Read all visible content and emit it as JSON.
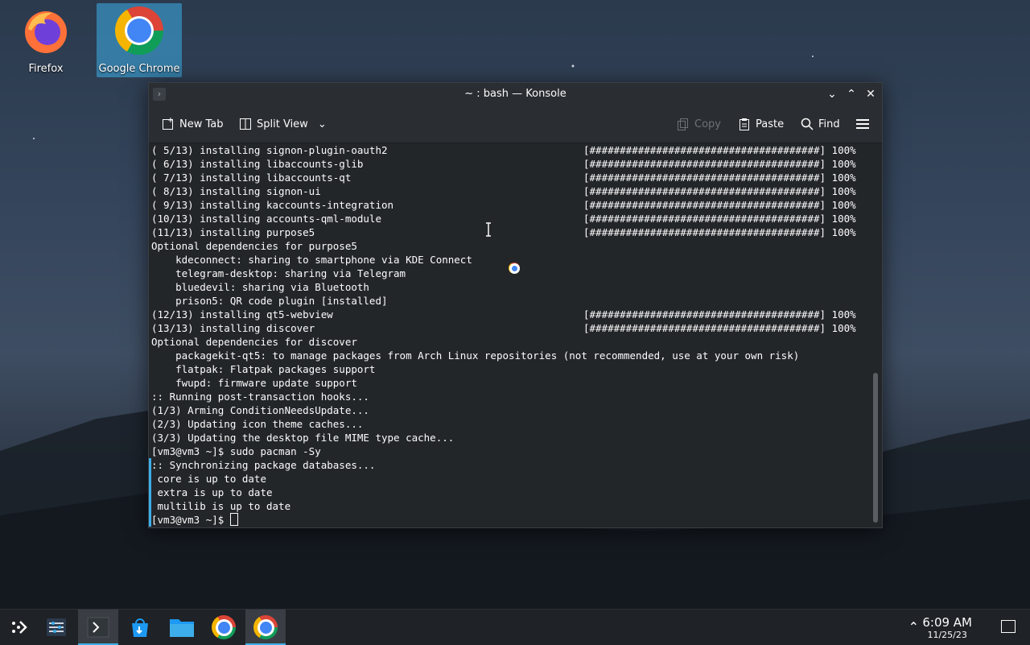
{
  "desktop": {
    "icons": [
      {
        "label": "Firefox"
      },
      {
        "label": "Google Chrome"
      }
    ]
  },
  "window": {
    "title": "~ : bash — Konsole",
    "toolbar": {
      "new_tab": "New Tab",
      "split_view": "Split View",
      "copy": "Copy",
      "paste": "Paste",
      "find": "Find"
    }
  },
  "terminal": {
    "lines": [
      {
        "text": "( 5/13) installing signon-plugin-oauth2",
        "progress": "[######################################] 100%"
      },
      {
        "text": "( 6/13) installing libaccounts-glib",
        "progress": "[######################################] 100%"
      },
      {
        "text": "( 7/13) installing libaccounts-qt",
        "progress": "[######################################] 100%"
      },
      {
        "text": "( 8/13) installing signon-ui",
        "progress": "[######################################] 100%"
      },
      {
        "text": "( 9/13) installing kaccounts-integration",
        "progress": "[######################################] 100%"
      },
      {
        "text": "(10/13) installing accounts-qml-module",
        "progress": "[######################################] 100%"
      },
      {
        "text": "(11/13) installing purpose5",
        "progress": "[######################################] 100%"
      },
      {
        "text": "Optional dependencies for purpose5",
        "progress": ""
      },
      {
        "text": "    kdeconnect: sharing to smartphone via KDE Connect",
        "progress": ""
      },
      {
        "text": "    telegram-desktop: sharing via Telegram",
        "progress": ""
      },
      {
        "text": "    bluedevil: sharing via Bluetooth",
        "progress": ""
      },
      {
        "text": "    prison5: QR code plugin [installed]",
        "progress": ""
      },
      {
        "text": "(12/13) installing qt5-webview",
        "progress": "[######################################] 100%"
      },
      {
        "text": "(13/13) installing discover",
        "progress": "[######################################] 100%"
      },
      {
        "text": "Optional dependencies for discover",
        "progress": ""
      },
      {
        "text": "    packagekit-qt5: to manage packages from Arch Linux repositories (not recommended, use at your own risk)",
        "progress": ""
      },
      {
        "text": "    flatpak: Flatpak packages support",
        "progress": ""
      },
      {
        "text": "    fwupd: firmware update support",
        "progress": ""
      },
      {
        "text": ":: Running post-transaction hooks...",
        "progress": ""
      },
      {
        "text": "(1/3) Arming ConditionNeedsUpdate...",
        "progress": ""
      },
      {
        "text": "(2/3) Updating icon theme caches...",
        "progress": ""
      },
      {
        "text": "(3/3) Updating the desktop file MIME type cache...",
        "progress": ""
      },
      {
        "text": "[vm3@vm3 ~]$ sudo pacman -Sy",
        "progress": ""
      },
      {
        "text": ":: Synchronizing package databases...",
        "progress": ""
      },
      {
        "text": " core is up to date",
        "progress": ""
      },
      {
        "text": " extra is up to date",
        "progress": ""
      },
      {
        "text": " multilib is up to date",
        "progress": ""
      },
      {
        "text": "[vm3@vm3 ~]$ ",
        "progress": ""
      }
    ]
  },
  "taskbar": {
    "time": "6:09 AM",
    "date": "11/25/23"
  },
  "colors": {
    "accent": "#3daee9",
    "window_bg": "#232629",
    "text": "#fcfcfc"
  }
}
